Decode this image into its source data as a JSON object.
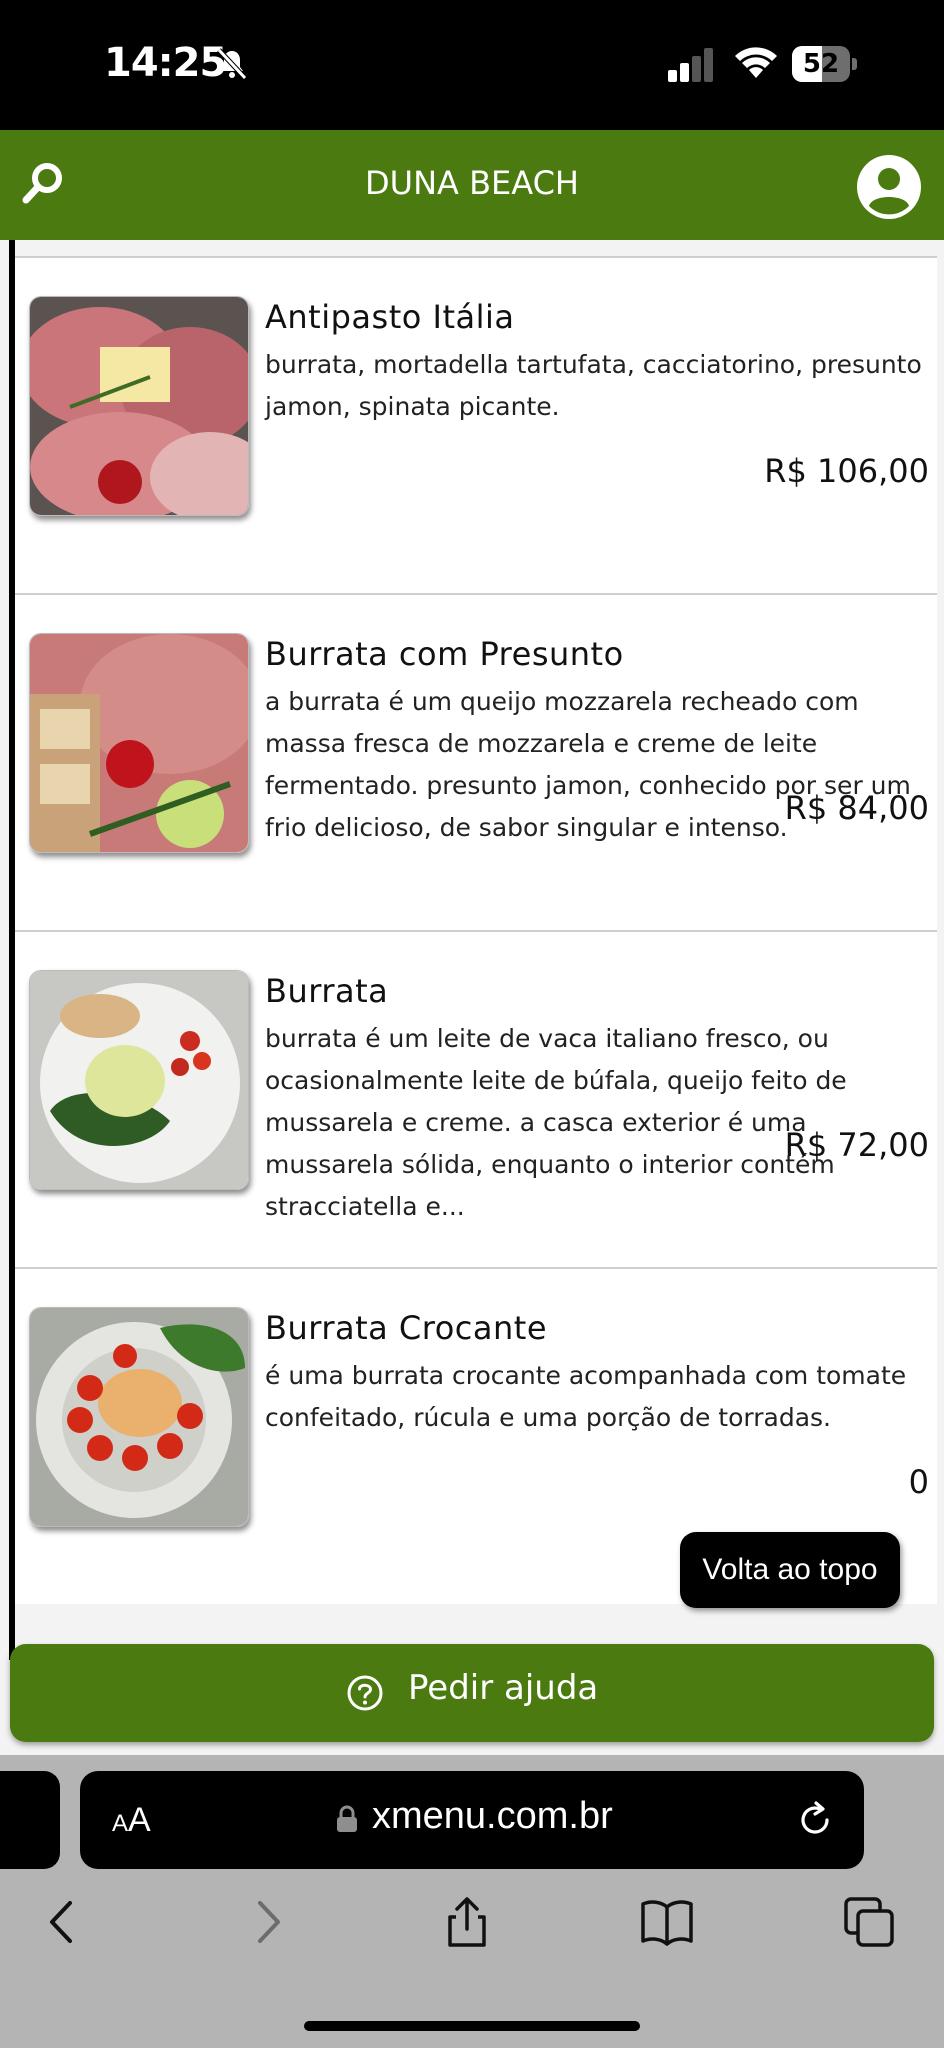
{
  "status_bar": {
    "time": "14:25",
    "battery": "52",
    "battery_level": 0.52
  },
  "header": {
    "title": "DUNA BEACH"
  },
  "menu": {
    "items": [
      {
        "name": "Antipasto Itália",
        "description": "burrata, mortadella tartufata, cacciatorino, presunto jamon, spinata picante.",
        "price": "R$ 106,00"
      },
      {
        "name": "Burrata com Presunto",
        "description": "a burrata é um queijo mozzarela recheado com massa fresca de mozzarela e creme de leite fermentado. presunto jamon, conhecido por ser um frio delicioso, de sabor singular e intenso.",
        "price": "R$ 84,00"
      },
      {
        "name": "Burrata",
        "description": "burrata é um leite de vaca italiano fresco, ou ocasionalmente leite de búfala, queijo feito de mussarela e creme. a casca exterior é uma mussarela sólida, enquanto o interior contém stracciatella e...",
        "price": "R$ 72,00"
      },
      {
        "name": "Burrata Crocante",
        "description": "é uma burrata crocante acompanhada com tomate confeitado, rúcula e uma porção de torradas.",
        "price": "0"
      }
    ]
  },
  "back_to_top": {
    "label": "Volta ao topo"
  },
  "help_button": {
    "label": "Pedir ajuda"
  },
  "browser": {
    "text_size_small": "A",
    "text_size_big": "A",
    "url": "xmenu.com.br"
  },
  "colors": {
    "brand_green": "#4a7a10",
    "status_bar": "#000000",
    "browser_chrome": "#b4b4b4"
  }
}
